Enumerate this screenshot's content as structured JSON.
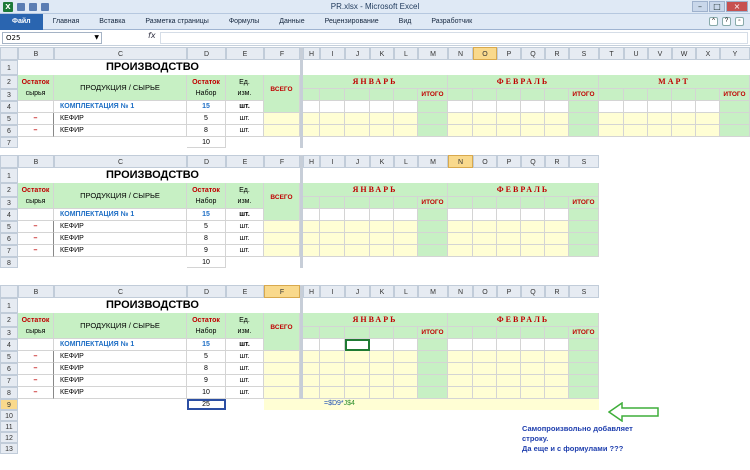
{
  "titlebar": {
    "title": "PR.xlsx - Microsoft Excel",
    "logo": "X"
  },
  "ribbon": {
    "file": "Файл",
    "tabs": [
      "Главная",
      "Вставка",
      "Разметка страницы",
      "Формулы",
      "Данные",
      "Рецензирование",
      "Вид",
      "Разработчик"
    ]
  },
  "formula_bar": {
    "name_box": "O25",
    "fx": "fx",
    "content": ""
  },
  "sheet": {
    "title": "ПРОИЗВОДСТВО",
    "hdr_ostatok": "Остаток",
    "hdr_syrya": "сырья",
    "hdr_product": "ПРОДУКЦИЯ / СЫРЬЕ",
    "hdr_nabor": "Набор",
    "hdr_ed1": "Ед.",
    "hdr_ed2": "изм.",
    "hdr_vsego": "ВСЕГО",
    "months": [
      "ЯНВАРЬ",
      "ФЕВРАЛЬ",
      "МАРТ"
    ],
    "itogo": "ИТОГО",
    "kit": "КОМПЛЕКТАЦИЯ № 1",
    "kit_val": "15",
    "unit_bold": "шт.",
    "unit": "шт.",
    "dash": "–",
    "item": "КЕФИР",
    "block1": {
      "rows": [
        "5",
        "8"
      ],
      "total": "10"
    },
    "block2": {
      "rows": [
        "5",
        "8",
        "9"
      ],
      "total": "10"
    },
    "block3": {
      "rows": [
        "5",
        "8",
        "9",
        "10"
      ],
      "total": "25"
    },
    "formula_cell_a": "=$D9*",
    "formula_cell_b": "J$4"
  },
  "annotation": {
    "line1": "Самопроизвольно добавляет",
    "line2": "строку.",
    "line3": "Да еще и с формулами ???"
  },
  "colors": {
    "green": "#c7f0c4",
    "yellow": "#fffed4",
    "red": "#c00000",
    "blue": "#1f6fc5"
  }
}
